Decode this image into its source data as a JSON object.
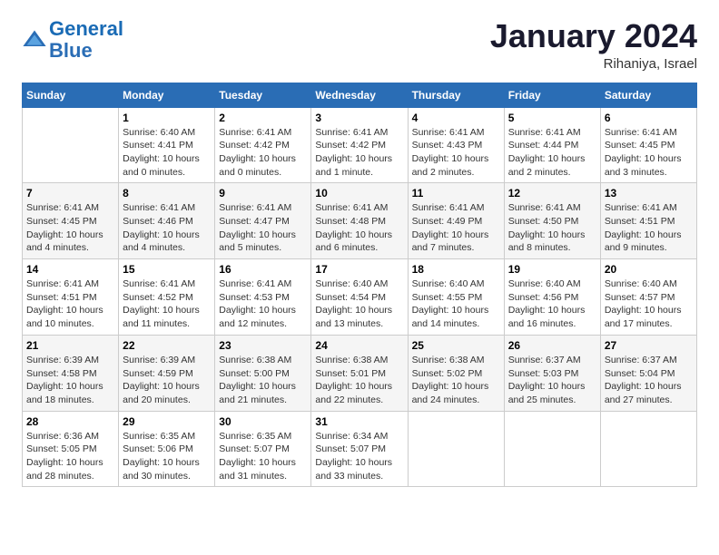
{
  "header": {
    "logo_line1": "General",
    "logo_line2": "Blue",
    "month": "January 2024",
    "location": "Rihaniya, Israel"
  },
  "weekdays": [
    "Sunday",
    "Monday",
    "Tuesday",
    "Wednesday",
    "Thursday",
    "Friday",
    "Saturday"
  ],
  "weeks": [
    [
      {
        "day": "",
        "info": ""
      },
      {
        "day": "1",
        "info": "Sunrise: 6:40 AM\nSunset: 4:41 PM\nDaylight: 10 hours\nand 0 minutes."
      },
      {
        "day": "2",
        "info": "Sunrise: 6:41 AM\nSunset: 4:42 PM\nDaylight: 10 hours\nand 0 minutes."
      },
      {
        "day": "3",
        "info": "Sunrise: 6:41 AM\nSunset: 4:42 PM\nDaylight: 10 hours\nand 1 minute."
      },
      {
        "day": "4",
        "info": "Sunrise: 6:41 AM\nSunset: 4:43 PM\nDaylight: 10 hours\nand 2 minutes."
      },
      {
        "day": "5",
        "info": "Sunrise: 6:41 AM\nSunset: 4:44 PM\nDaylight: 10 hours\nand 2 minutes."
      },
      {
        "day": "6",
        "info": "Sunrise: 6:41 AM\nSunset: 4:45 PM\nDaylight: 10 hours\nand 3 minutes."
      }
    ],
    [
      {
        "day": "7",
        "info": "Sunrise: 6:41 AM\nSunset: 4:45 PM\nDaylight: 10 hours\nand 4 minutes."
      },
      {
        "day": "8",
        "info": "Sunrise: 6:41 AM\nSunset: 4:46 PM\nDaylight: 10 hours\nand 4 minutes."
      },
      {
        "day": "9",
        "info": "Sunrise: 6:41 AM\nSunset: 4:47 PM\nDaylight: 10 hours\nand 5 minutes."
      },
      {
        "day": "10",
        "info": "Sunrise: 6:41 AM\nSunset: 4:48 PM\nDaylight: 10 hours\nand 6 minutes."
      },
      {
        "day": "11",
        "info": "Sunrise: 6:41 AM\nSunset: 4:49 PM\nDaylight: 10 hours\nand 7 minutes."
      },
      {
        "day": "12",
        "info": "Sunrise: 6:41 AM\nSunset: 4:50 PM\nDaylight: 10 hours\nand 8 minutes."
      },
      {
        "day": "13",
        "info": "Sunrise: 6:41 AM\nSunset: 4:51 PM\nDaylight: 10 hours\nand 9 minutes."
      }
    ],
    [
      {
        "day": "14",
        "info": "Sunrise: 6:41 AM\nSunset: 4:51 PM\nDaylight: 10 hours\nand 10 minutes."
      },
      {
        "day": "15",
        "info": "Sunrise: 6:41 AM\nSunset: 4:52 PM\nDaylight: 10 hours\nand 11 minutes."
      },
      {
        "day": "16",
        "info": "Sunrise: 6:41 AM\nSunset: 4:53 PM\nDaylight: 10 hours\nand 12 minutes."
      },
      {
        "day": "17",
        "info": "Sunrise: 6:40 AM\nSunset: 4:54 PM\nDaylight: 10 hours\nand 13 minutes."
      },
      {
        "day": "18",
        "info": "Sunrise: 6:40 AM\nSunset: 4:55 PM\nDaylight: 10 hours\nand 14 minutes."
      },
      {
        "day": "19",
        "info": "Sunrise: 6:40 AM\nSunset: 4:56 PM\nDaylight: 10 hours\nand 16 minutes."
      },
      {
        "day": "20",
        "info": "Sunrise: 6:40 AM\nSunset: 4:57 PM\nDaylight: 10 hours\nand 17 minutes."
      }
    ],
    [
      {
        "day": "21",
        "info": "Sunrise: 6:39 AM\nSunset: 4:58 PM\nDaylight: 10 hours\nand 18 minutes."
      },
      {
        "day": "22",
        "info": "Sunrise: 6:39 AM\nSunset: 4:59 PM\nDaylight: 10 hours\nand 20 minutes."
      },
      {
        "day": "23",
        "info": "Sunrise: 6:38 AM\nSunset: 5:00 PM\nDaylight: 10 hours\nand 21 minutes."
      },
      {
        "day": "24",
        "info": "Sunrise: 6:38 AM\nSunset: 5:01 PM\nDaylight: 10 hours\nand 22 minutes."
      },
      {
        "day": "25",
        "info": "Sunrise: 6:38 AM\nSunset: 5:02 PM\nDaylight: 10 hours\nand 24 minutes."
      },
      {
        "day": "26",
        "info": "Sunrise: 6:37 AM\nSunset: 5:03 PM\nDaylight: 10 hours\nand 25 minutes."
      },
      {
        "day": "27",
        "info": "Sunrise: 6:37 AM\nSunset: 5:04 PM\nDaylight: 10 hours\nand 27 minutes."
      }
    ],
    [
      {
        "day": "28",
        "info": "Sunrise: 6:36 AM\nSunset: 5:05 PM\nDaylight: 10 hours\nand 28 minutes."
      },
      {
        "day": "29",
        "info": "Sunrise: 6:35 AM\nSunset: 5:06 PM\nDaylight: 10 hours\nand 30 minutes."
      },
      {
        "day": "30",
        "info": "Sunrise: 6:35 AM\nSunset: 5:07 PM\nDaylight: 10 hours\nand 31 minutes."
      },
      {
        "day": "31",
        "info": "Sunrise: 6:34 AM\nSunset: 5:07 PM\nDaylight: 10 hours\nand 33 minutes."
      },
      {
        "day": "",
        "info": ""
      },
      {
        "day": "",
        "info": ""
      },
      {
        "day": "",
        "info": ""
      }
    ]
  ]
}
